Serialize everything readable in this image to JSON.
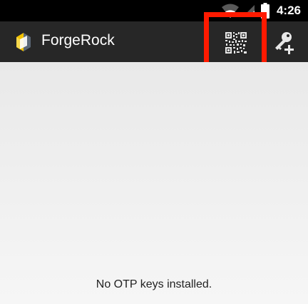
{
  "status_bar": {
    "time": "4:26",
    "icons": [
      "wifi-icon",
      "signal-icon",
      "battery-icon"
    ]
  },
  "action_bar": {
    "title": "ForgeRock",
    "logo_icon": "forgerock-logo-icon",
    "actions": [
      {
        "name": "scan-qr-code",
        "icon": "qr-code-icon",
        "highlighted": true
      },
      {
        "name": "add-key",
        "icon": "key-add-icon"
      }
    ]
  },
  "main": {
    "empty_message": "No OTP keys installed."
  },
  "colors": {
    "status_bar": "#000000",
    "action_bar": "#272727",
    "content_background": "#ededed",
    "highlight": "#ff1a00"
  }
}
